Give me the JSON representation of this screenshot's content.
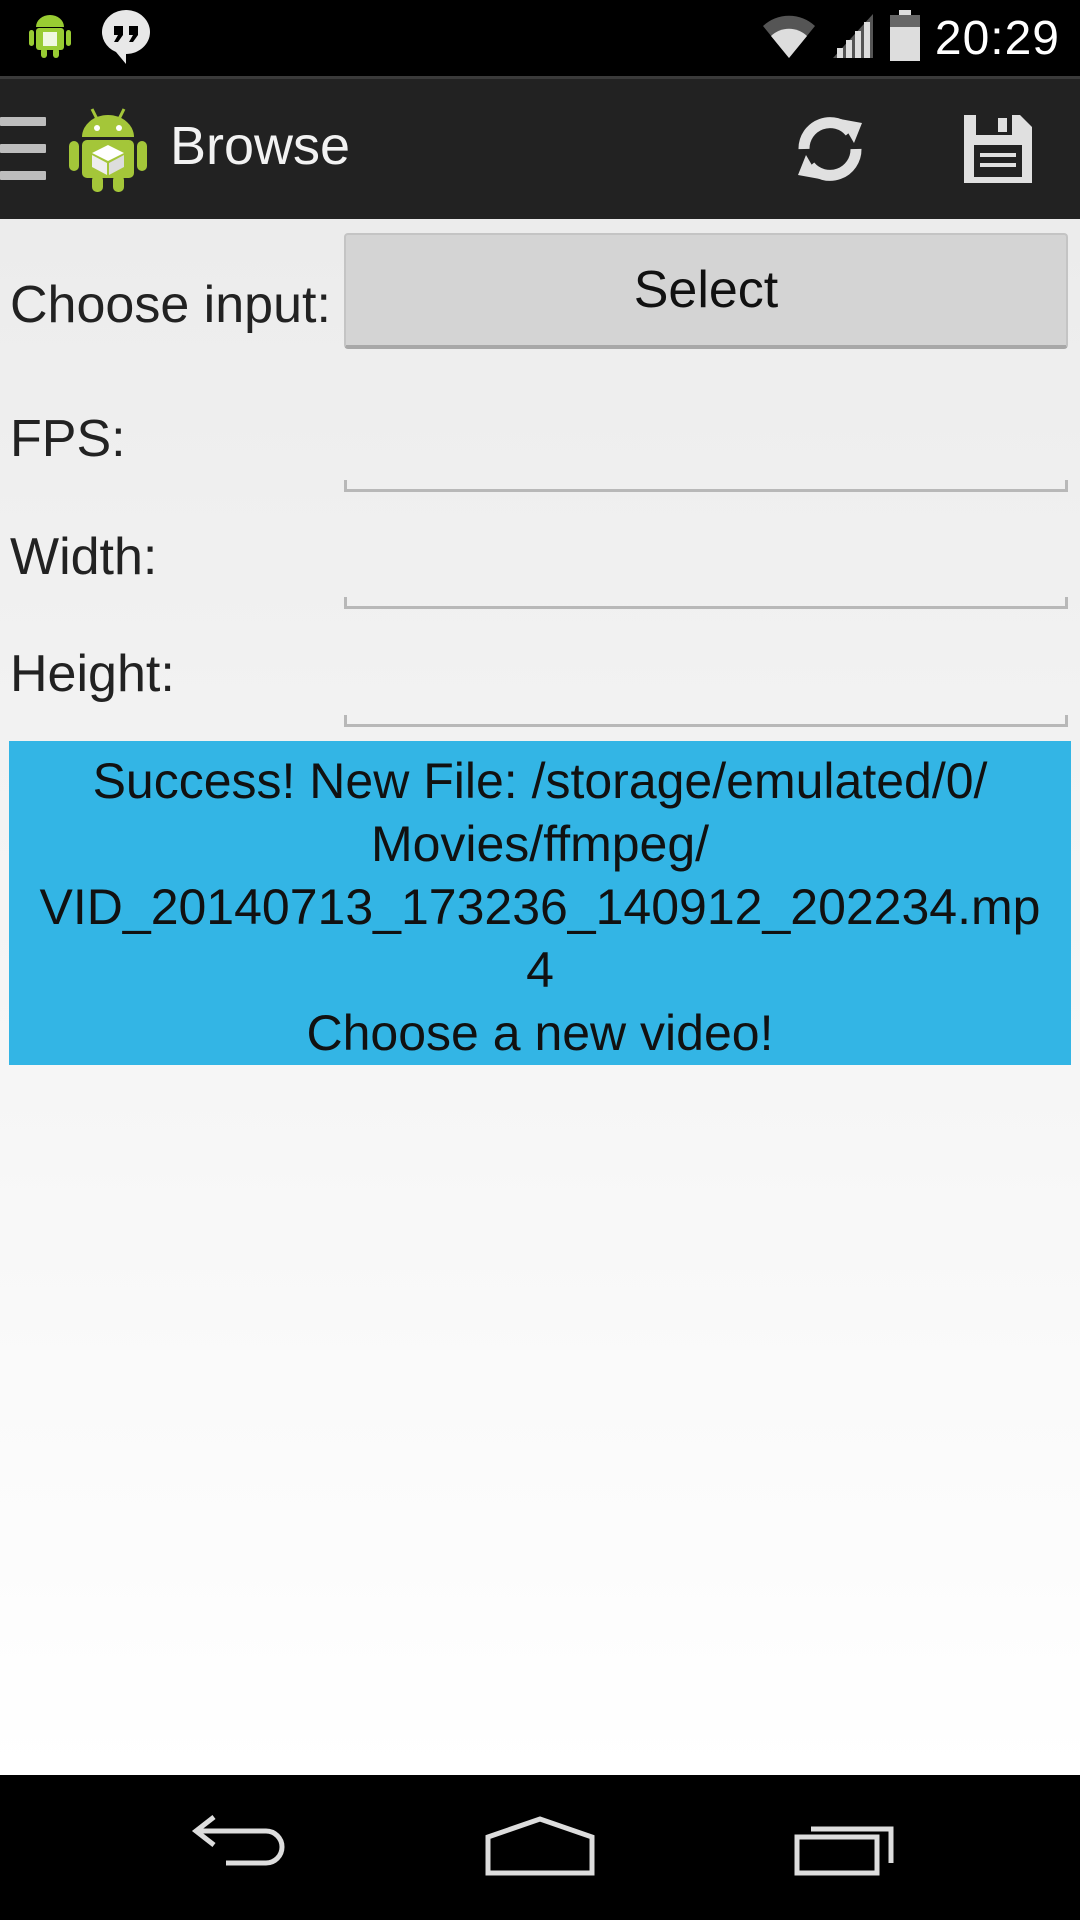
{
  "status_bar": {
    "time": "20:29",
    "icons": [
      "android-notification-icon",
      "hangouts-icon",
      "wifi-icon",
      "signal-icon",
      "battery-icon"
    ]
  },
  "action_bar": {
    "title": "Browse",
    "actions": [
      "refresh-icon",
      "save-icon"
    ]
  },
  "form": {
    "choose_input_label": "Choose input:",
    "select_button": "Select",
    "fps_label": "FPS:",
    "fps_value": "",
    "width_label": "Width:",
    "width_value": "",
    "height_label": "Height:",
    "height_value": ""
  },
  "message": {
    "lines": [
      "Success! New File: /storage/emulated/0/",
      "Movies/ffmpeg/",
      "VID_20140713_173236_140912_202234.mp",
      "4",
      "Choose a new video!"
    ]
  },
  "nav_bar": {
    "buttons": [
      "back-icon",
      "home-icon",
      "recents-icon"
    ]
  },
  "colors": {
    "message_bg": "#33b5e5",
    "action_bar_bg": "#222222"
  }
}
